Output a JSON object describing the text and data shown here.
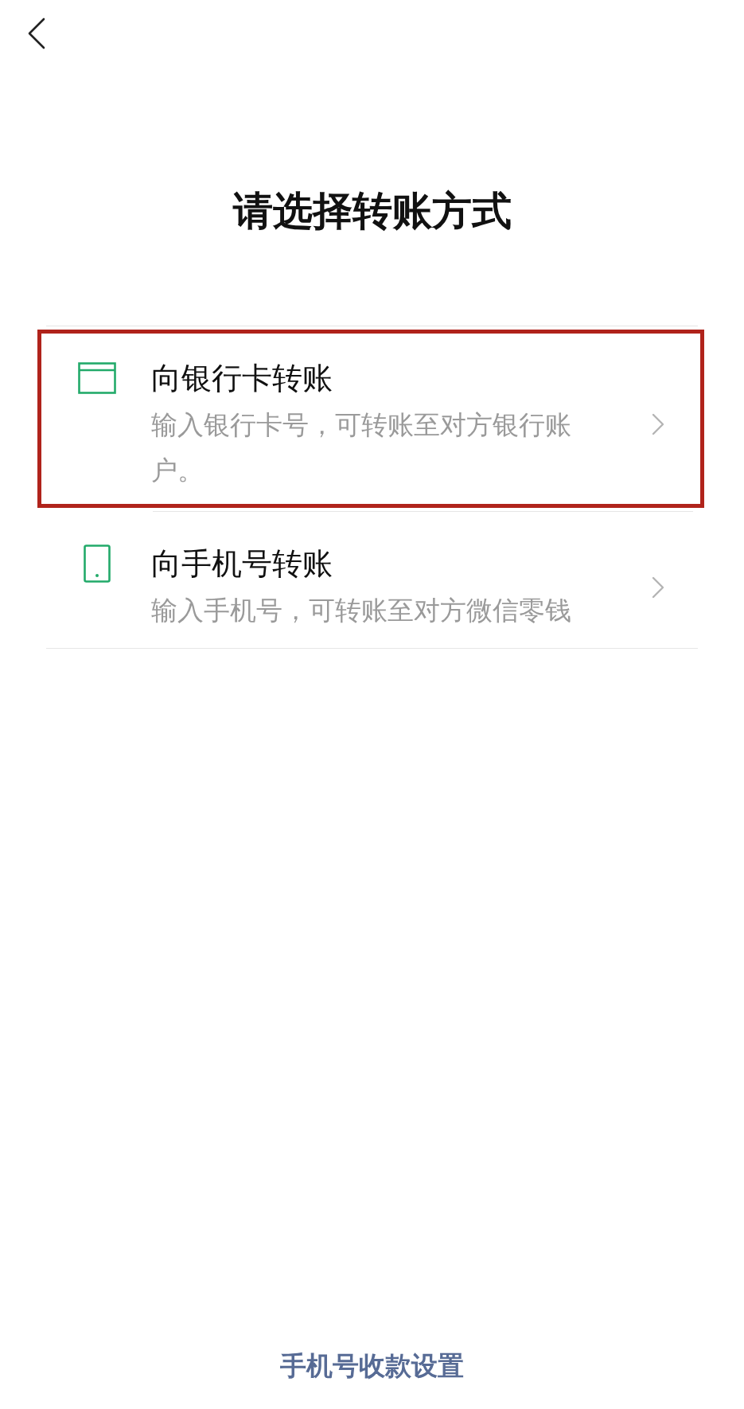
{
  "header": {
    "title": "请选择转账方式"
  },
  "options": [
    {
      "kind": "card",
      "title": "向银行卡转账",
      "description": "输入银行卡号，可转账至对方银行账户。",
      "highlighted": true
    },
    {
      "kind": "phone",
      "title": "向手机号转账",
      "description": "输入手机号，可转账至对方微信零钱",
      "highlighted": false
    }
  ],
  "footer": {
    "link": "手机号收款设置"
  }
}
